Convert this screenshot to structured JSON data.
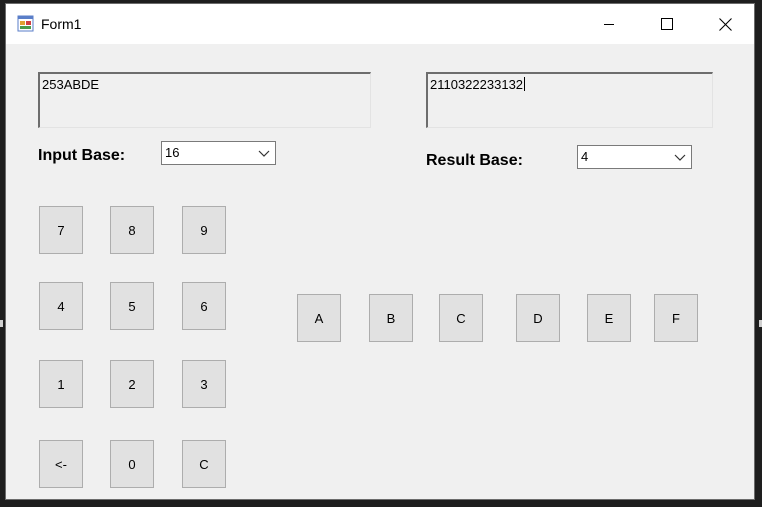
{
  "window": {
    "title": "Form1"
  },
  "input": {
    "value": "253ABDE",
    "base_label": "Input Base:",
    "base_value": "16"
  },
  "result": {
    "value": "2110322233132",
    "base_label": "Result Base:",
    "base_value": "4"
  },
  "keypad": {
    "k7": "7",
    "k8": "8",
    "k9": "9",
    "k4": "4",
    "k5": "5",
    "k6": "6",
    "k1": "1",
    "k2": "2",
    "k3": "3",
    "back": "<-",
    "k0": "0",
    "clear": "C"
  },
  "hexpad": {
    "a": "A",
    "b": "B",
    "c": "C",
    "d": "D",
    "e": "E",
    "f": "F"
  },
  "icons": {
    "app": "form-app-icon",
    "minimize": "minimize-icon",
    "maximize": "maximize-icon",
    "close": "close-icon",
    "dropdown": "chevron-down-icon"
  }
}
